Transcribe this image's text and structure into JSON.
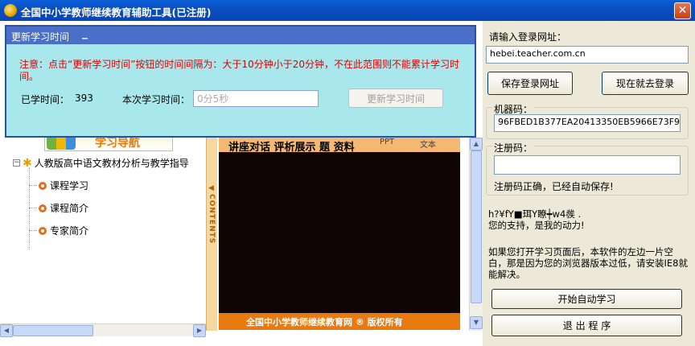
{
  "window": {
    "title": "全国中小学教师继续教育辅助工具(已注册)",
    "close_glyph": "✕"
  },
  "dialog": {
    "title": "更新学习时间",
    "minimize_glyph": "_",
    "notice": "注意：点击“更新学习时间”按钮的时间间隔为：大于10分钟小于20分钟，不在此范围则不能累计学习时间。",
    "studied_label": "已学时间：",
    "studied_value": "393",
    "this_time_label": "本次学习时间：",
    "this_time_value": "0分5秒",
    "update_button": "更新学习时间"
  },
  "browser": {
    "nav_logo_text": "学习导航",
    "tree": {
      "root": "人教版高中语文教材分析与教学指导",
      "items": [
        "课程学习",
        "课程简介",
        "专家简介"
      ]
    },
    "contents_label": "CONTENTS",
    "video": {
      "header": "讲座对话 评析展示  题  资料",
      "ppt": "PPT",
      "text": "文本",
      "footer": "全国中小学教师继续教育网 ® 版权所有"
    }
  },
  "right_panel": {
    "login_url_label": "请输入登录网址：",
    "login_url": "hebei.teacher.com.cn",
    "save_url_button": "保存登录网址",
    "login_now_button": "现在就去登录",
    "machine_code_label": "机器码：",
    "machine_code": "96FBED1B377EA20413350EB5966E73F9",
    "reg_code_label": "注册码：",
    "reg_code": "",
    "reg_ok": "注册码正确，已经自动保存!",
    "thanks_garbled": "h?¥fY■珥Y瞭┿w4彂 .",
    "thanks": "您的支持，是我的动力!",
    "hint": "如果您打开学习页面后，本软件的左边一片空白，那是因为您的浏览器版本过低，请安装IE8就能解决。",
    "auto_study_button": "开始自动学习",
    "exit_button": "退 出 程 序"
  }
}
